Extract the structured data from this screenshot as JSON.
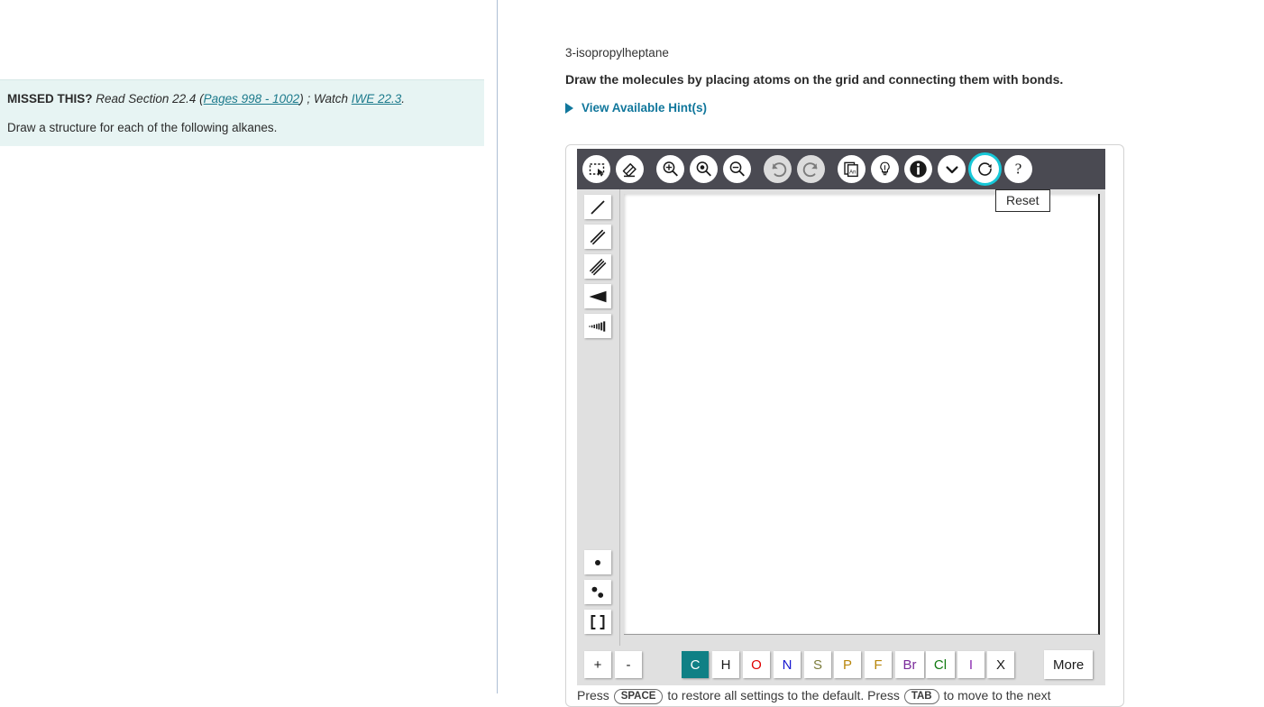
{
  "left_panel": {
    "missed_this_label": "MISSED THIS?",
    "read_text": "Read Section 22.4 (",
    "pages_link": "Pages 998 - 1002",
    "watch_text": ") ; Watch ",
    "iwe_link": "IWE 22.3",
    "period": ".",
    "instruction": "Draw a structure for each of the following alkanes."
  },
  "right_panel": {
    "compound_name": "3-isopropylheptane",
    "draw_instruction": "Draw the molecules by placing atoms on the grid and connecting them with bonds.",
    "hints_label": "View Available Hint(s)",
    "hints_arrow_icon": "triangle-right-icon"
  },
  "editor": {
    "toolbar": [
      {
        "name": "marquee-select-tool",
        "icon": "marquee-select-icon",
        "label": "Select",
        "state": "white"
      },
      {
        "name": "eraser-tool",
        "icon": "eraser-icon",
        "label": "Erase",
        "state": "white"
      },
      {
        "name": "zoom-in-tool",
        "icon": "zoom-in-icon",
        "label": "Zoom In",
        "state": "white"
      },
      {
        "name": "zoom-fit-tool",
        "icon": "zoom-fit-icon",
        "label": "Zoom to Fit",
        "state": "white"
      },
      {
        "name": "zoom-out-tool",
        "icon": "zoom-out-icon",
        "label": "Zoom Out",
        "state": "white"
      },
      {
        "name": "undo-button",
        "icon": "undo-icon",
        "label": "Undo",
        "state": "dim"
      },
      {
        "name": "redo-button",
        "icon": "redo-icon",
        "label": "Redo",
        "state": "dim"
      },
      {
        "name": "copy-as-text-button",
        "icon": "copy-document-icon",
        "label": "Copy",
        "state": "white"
      },
      {
        "name": "hint-bulb-button",
        "icon": "lightbulb-icon",
        "label": "Hint",
        "state": "white"
      },
      {
        "name": "info-button",
        "icon": "info-icon",
        "label": "Info",
        "state": "white"
      },
      {
        "name": "more-options-button",
        "icon": "chevron-down-icon",
        "label": "More Options",
        "state": "white"
      },
      {
        "name": "reset-button",
        "icon": "reset-circular-arrow-icon",
        "label": "Reset",
        "state": "selected"
      },
      {
        "name": "help-button",
        "icon": "question-mark-icon",
        "label": "Help",
        "state": "white"
      }
    ],
    "tooltip": {
      "text": "Reset",
      "for": "reset-button"
    },
    "bond_tools": [
      {
        "name": "single-bond-tool",
        "icon": "single-bond-icon",
        "label": "Single Bond"
      },
      {
        "name": "double-bond-tool",
        "icon": "double-bond-icon",
        "label": "Double Bond"
      },
      {
        "name": "triple-bond-tool",
        "icon": "triple-bond-icon",
        "label": "Triple Bond"
      },
      {
        "name": "wedge-bond-tool",
        "icon": "wedge-bond-icon",
        "label": "Wedge Bond"
      },
      {
        "name": "hash-bond-tool",
        "icon": "hash-bond-icon",
        "label": "Hashed Bond"
      }
    ],
    "annotation_tools": [
      {
        "name": "radical-electron-tool",
        "icon": "single-dot-icon",
        "label": "Radical Electron"
      },
      {
        "name": "lone-pair-tool",
        "icon": "two-dots-icon",
        "label": "Lone Pair"
      },
      {
        "name": "bracket-charge-tool",
        "icon": "brackets-icon",
        "label": "Brackets"
      }
    ],
    "charge_buttons": [
      {
        "name": "increase-charge-button",
        "label": "+"
      },
      {
        "name": "decrease-charge-button",
        "label": "-"
      }
    ],
    "elements": [
      {
        "symbol": "C",
        "color": "#ffffff",
        "active": true
      },
      {
        "symbol": "H",
        "color": "#1a1a1a",
        "active": false
      },
      {
        "symbol": "O",
        "color": "#e00000",
        "active": false
      },
      {
        "symbol": "N",
        "color": "#1616d0",
        "active": false
      },
      {
        "symbol": "S",
        "color": "#7b7b3a",
        "active": false
      },
      {
        "symbol": "P",
        "color": "#b8860b",
        "active": false
      },
      {
        "symbol": "F",
        "color": "#b8860b",
        "active": false
      },
      {
        "symbol": "Br",
        "color": "#7a2a9a",
        "active": false
      },
      {
        "symbol": "Cl",
        "color": "#117a11",
        "active": false
      },
      {
        "symbol": "I",
        "color": "#8b2ab0",
        "active": false
      },
      {
        "symbol": "X",
        "color": "#1a1a1a",
        "active": false
      }
    ],
    "more_button_label": "More",
    "footer": {
      "part1": "Press ",
      "key1": "SPACE",
      "part2": " to restore all settings to the default. Press ",
      "key2": "TAB",
      "part3": " to move to the next"
    }
  },
  "colors": {
    "accent_teal": "#0f8085",
    "link_teal": "#1c7a8c",
    "hint_blue": "#11779c",
    "toolbar_dark": "#4a4a52",
    "selection_ring": "#17c8d8",
    "missed_bg": "#e7f4f3"
  }
}
